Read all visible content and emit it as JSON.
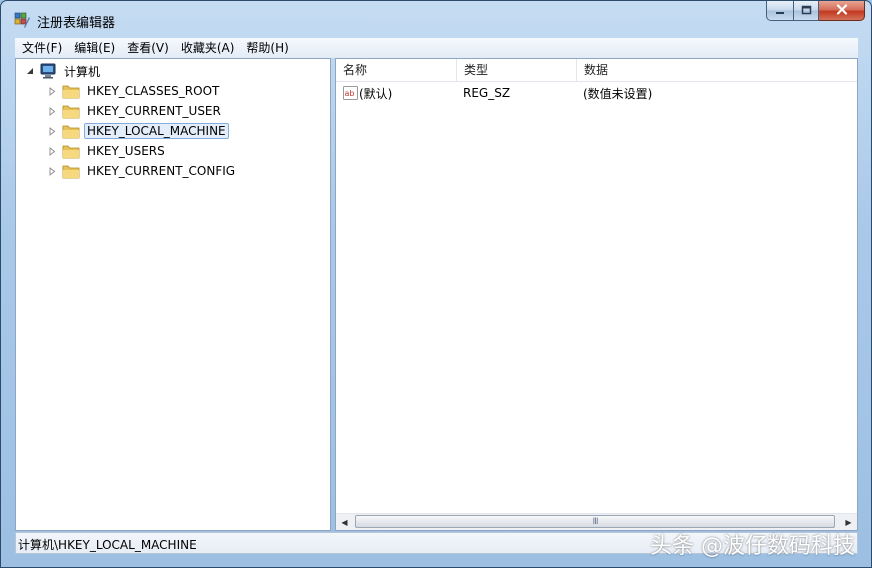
{
  "window": {
    "title": "注册表编辑器"
  },
  "menu": [
    "文件(F)",
    "编辑(E)",
    "查看(V)",
    "收藏夹(A)",
    "帮助(H)"
  ],
  "tree": {
    "root": "计算机",
    "children": [
      "HKEY_CLASSES_ROOT",
      "HKEY_CURRENT_USER",
      "HKEY_LOCAL_MACHINE",
      "HKEY_USERS",
      "HKEY_CURRENT_CONFIG"
    ],
    "selected": "HKEY_LOCAL_MACHINE"
  },
  "list": {
    "columns": [
      "名称",
      "类型",
      "数据"
    ],
    "rows": [
      {
        "icon": "string-value-icon",
        "name": "(默认)",
        "type": "REG_SZ",
        "data": "(数值未设置)"
      }
    ],
    "scrollbar_grip": "III"
  },
  "status": {
    "path": "计算机\\HKEY_LOCAL_MACHINE"
  },
  "watermark": "头条 @波仔数码科技",
  "colors": {
    "accent": "#2c4a6b",
    "selection": "#e3eefa",
    "close_button": "#c1391f"
  }
}
